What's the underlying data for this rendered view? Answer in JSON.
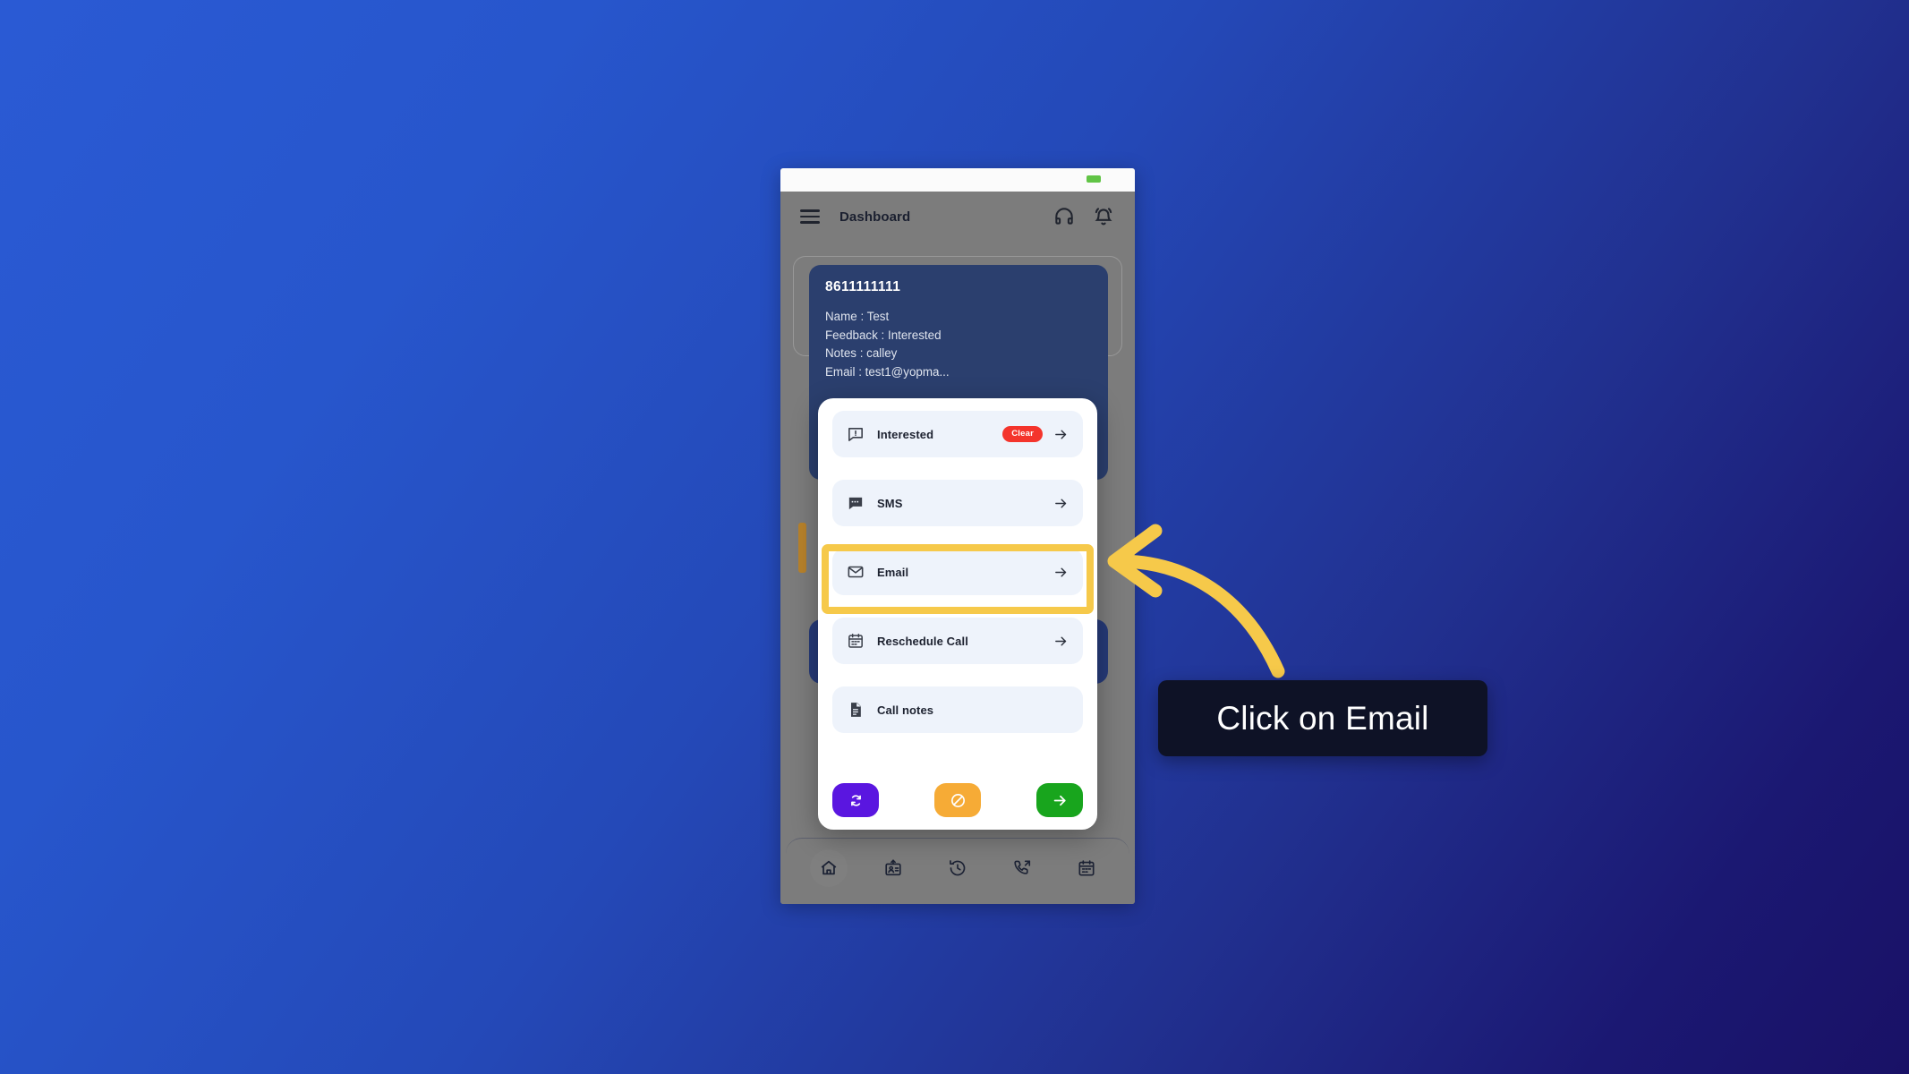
{
  "background": {
    "gradient_from": "#2a5ad4",
    "gradient_to": "#191166"
  },
  "phone": {
    "status_bar": {
      "battery_icon": "battery-icon",
      "battery_color": "#61c446"
    },
    "app_bar": {
      "menu_icon": "hamburger-menu-icon",
      "title": "Dashboard",
      "headset_icon": "headset-support-icon",
      "bell_icon": "notification-bell-icon"
    },
    "lead_card": {
      "phone_number": "8611111111",
      "lines": [
        "Name : Test",
        "Feedback : Interested",
        "Notes : calley",
        "Email : test1@yopma..."
      ]
    },
    "bottom_nav": {
      "items": [
        {
          "name": "home",
          "icon": "home-icon",
          "active": true
        },
        {
          "name": "upload-leads",
          "icon": "upload-contact-icon",
          "active": false
        },
        {
          "name": "history",
          "icon": "history-clock-icon",
          "active": false
        },
        {
          "name": "calls",
          "icon": "call-forward-icon",
          "active": false
        },
        {
          "name": "calendar",
          "icon": "calendar-icon",
          "active": false
        }
      ]
    }
  },
  "sheet": {
    "rows": [
      {
        "label": "Interested",
        "icon": "feedback-bubble-icon",
        "badge": "Clear",
        "badge_color": "#f4342c",
        "arrow": "arrow-right-icon"
      },
      {
        "label": "SMS",
        "icon": "sms-bubble-icon",
        "badge": null,
        "arrow": "arrow-right-icon"
      },
      {
        "label": "Email",
        "icon": "envelope-icon",
        "badge": null,
        "arrow": "arrow-right-icon",
        "highlighted": true
      },
      {
        "label": "Reschedule Call",
        "icon": "calendar-icon",
        "badge": null,
        "arrow": "arrow-right-icon"
      },
      {
        "label": "Call notes",
        "icon": "notes-document-icon",
        "badge": null,
        "arrow": null
      }
    ],
    "actions": [
      {
        "name": "refresh",
        "icon": "refresh-icon",
        "color": "#5a16e0"
      },
      {
        "name": "block",
        "icon": "block-icon",
        "color": "#f6ab36"
      },
      {
        "name": "next",
        "icon": "arrow-right-icon",
        "color": "#18a51d"
      }
    ]
  },
  "annotation": {
    "highlight_color": "#f6c94a",
    "arrow_icon": "curved-arrow-left-icon",
    "arrow_color": "#f6c94a",
    "tooltip_text": "Click on Email",
    "tooltip_bg": "#0e1226"
  }
}
